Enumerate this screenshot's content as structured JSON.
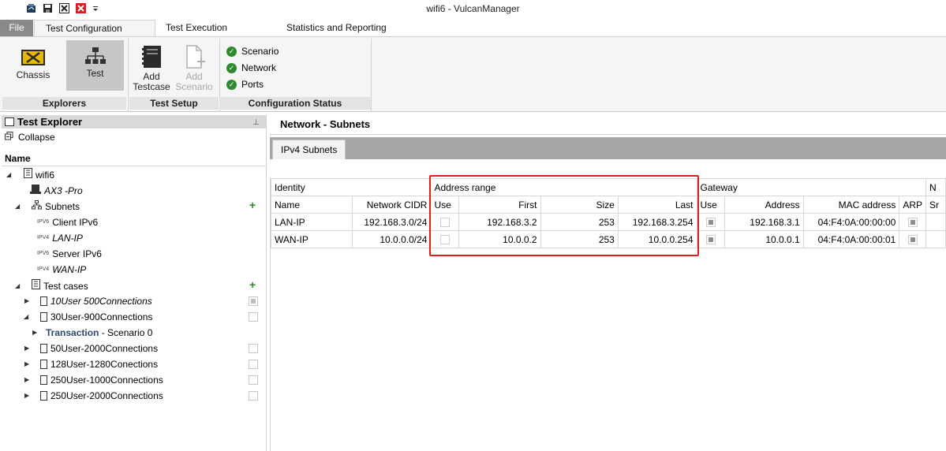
{
  "window": {
    "title": "wifi6 - VulcanManager"
  },
  "quick_access": {
    "icons": [
      "open-icon",
      "save-icon",
      "close-icon",
      "close-all-icon",
      "dropdown-icon"
    ]
  },
  "ribbon": {
    "tabs": [
      "File",
      "Test Configuration",
      "Test Execution",
      "Statistics and Reporting"
    ],
    "active_tab": "Test Configuration",
    "explorers": {
      "label": "Explorers",
      "chassis": "Chassis",
      "test": "Test"
    },
    "test_setup": {
      "label": "Test Setup",
      "add_testcase": [
        "Add",
        "Testcase"
      ],
      "add_scenario": [
        "Add",
        "Scenario"
      ]
    },
    "config_status": {
      "label": "Configuration Status",
      "items": [
        "Scenario",
        "Network",
        "Ports"
      ]
    }
  },
  "explorer": {
    "title": "Test Explorer",
    "collapse": "Collapse",
    "name_header": "Name",
    "tree": {
      "root": "wifi6",
      "device": "AX3 -Pro",
      "subnets": "Subnets",
      "subnet_items": [
        {
          "tag": "IPV6",
          "label": "Client IPv6",
          "italic": false
        },
        {
          "tag": "IPV4",
          "label": "LAN-IP",
          "italic": true
        },
        {
          "tag": "IPV6",
          "label": "Server IPv6",
          "italic": false
        },
        {
          "tag": "IPV4",
          "label": "WAN-IP",
          "italic": true
        }
      ],
      "test_cases": "Test cases",
      "cases": [
        {
          "label": "10User 500Connections",
          "italic": true
        },
        {
          "label": "30User-900Connections",
          "italic": false
        },
        {
          "label": "50User-2000Connections",
          "italic": false
        },
        {
          "label": "128User-1280Conections",
          "italic": false
        },
        {
          "label": "250User-1000Connections",
          "italic": false
        },
        {
          "label": "250User-2000Connections",
          "italic": false
        }
      ],
      "transaction": {
        "bold": "Transaction",
        "rest": " - Scenario 0"
      }
    }
  },
  "main": {
    "title": "Network - Subnets",
    "subtab": "IPv4 Subnets",
    "groups": {
      "identity": "Identity",
      "address_range": "Address range",
      "gateway": "Gateway",
      "more": "N"
    },
    "columns": [
      "Name",
      "Network CIDR",
      "Use",
      "First",
      "Size",
      "Last",
      "Use",
      "Address",
      "MAC address",
      "ARP",
      "Sr"
    ],
    "rows": [
      {
        "name": "LAN-IP",
        "cidr": "192.168.3.0/24",
        "range_use": false,
        "first": "192.168.3.2",
        "size": "253",
        "last": "192.168.3.254",
        "gw_use": true,
        "address": "192.168.3.1",
        "mac": "04:F4:0A:00:00:00",
        "arp": true
      },
      {
        "name": "WAN-IP",
        "cidr": "10.0.0.0/24",
        "range_use": false,
        "first": "10.0.0.2",
        "size": "253",
        "last": "10.0.0.254",
        "gw_use": true,
        "address": "10.0.0.1",
        "mac": "04:F4:0A:00:00:01",
        "arp": true
      }
    ]
  },
  "colors": {
    "highlight_box": "#e01e1e",
    "check_green": "#2f8a2f",
    "add_green": "#2a8a2a"
  }
}
